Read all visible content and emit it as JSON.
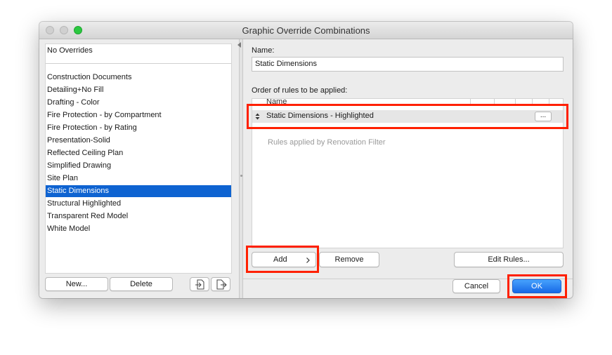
{
  "window": {
    "title": "Graphic Override Combinations"
  },
  "combinations": {
    "none_label": "No Overrides",
    "items": [
      "Construction Documents",
      "Detailing+No Fill",
      "Drafting - Color",
      "Fire Protection - by Compartment",
      "Fire Protection - by Rating",
      "Presentation-Solid",
      "Reflected Ceiling Plan",
      "Simplified Drawing",
      "Site Plan",
      "Static Dimensions",
      "Structural Highlighted",
      "Transparent Red Model",
      "White Model"
    ],
    "selected": "Static Dimensions",
    "new_label": "New...",
    "delete_label": "Delete"
  },
  "detail": {
    "name_label": "Name:",
    "name_value": "Static Dimensions",
    "order_label": "Order of rules to be applied:",
    "column_name": "Name",
    "rule": {
      "name": "Static Dimensions - Highlighted",
      "more_label": "..."
    },
    "renovation_text": "Rules applied by Renovation Filter",
    "add_label": "Add",
    "remove_label": "Remove",
    "edit_rules_label": "Edit Rules..."
  },
  "footer": {
    "cancel_label": "Cancel",
    "ok_label": "OK"
  },
  "colors": {
    "selection": "#0e63d1",
    "highlight": "#ff2000",
    "ok_button": "#1769e6"
  }
}
